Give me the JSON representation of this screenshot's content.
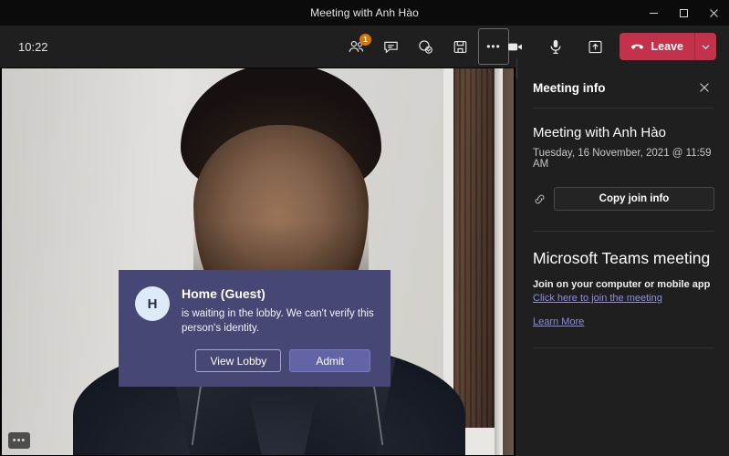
{
  "window": {
    "title": "Meeting with Anh Hào",
    "controls": {
      "minimize": "Minimize",
      "maximize": "Maximize",
      "close": "Close"
    }
  },
  "toolbar": {
    "clock": "10:22",
    "participants_label": "People",
    "participants_badge": "1",
    "chat_label": "Chat",
    "reactions_label": "Reactions",
    "breakout_label": "Breakout rooms",
    "more_label": "More actions",
    "more_glyph": "•••",
    "camera_label": "Camera",
    "mic_label": "Microphone",
    "share_label": "Share content",
    "leave_label": "Leave",
    "leave_caret_label": "Leave options",
    "leave_color": "#c4314b"
  },
  "stage": {
    "more_glyph": "•••",
    "more_label": "More options"
  },
  "panel": {
    "header_title": "Meeting info",
    "close_label": "Close",
    "meeting_name": "Meeting with Anh Hào",
    "meeting_date": "Tuesday, 16 November, 2021 @ 11:59 AM",
    "link_icon_label": "link-icon",
    "copy_join_info": "Copy join info",
    "teams_meeting_title": "Microsoft Teams meeting",
    "join_subtitle": "Join on your computer or mobile app",
    "join_link": "Click here to join the meeting",
    "learn_more": "Learn More",
    "link_color": "#8f8de0"
  },
  "toast": {
    "avatar_initial": "H",
    "name": "Home (Guest)",
    "message": "is waiting in the lobby. We can't verify this person's identity.",
    "view_lobby": "View Lobby",
    "admit": "Admit",
    "bg_color": "#464775",
    "primary_color": "#6264a7"
  }
}
